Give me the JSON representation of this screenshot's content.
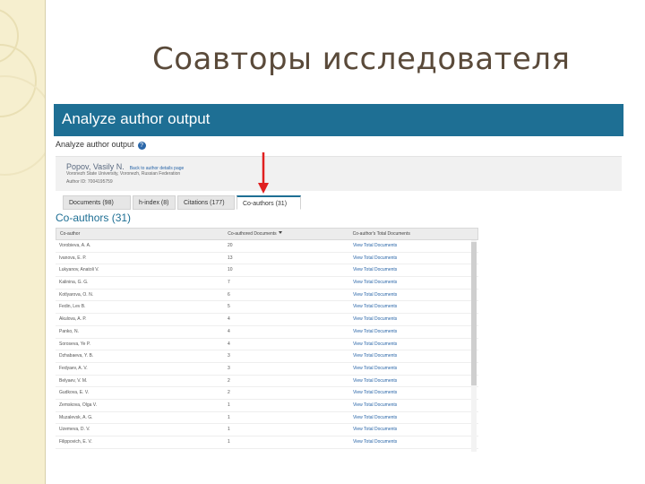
{
  "slide": {
    "title": "Соавторы исследователя"
  },
  "app": {
    "header": "Analyze author output",
    "breadcrumb": "Analyze author output",
    "help_glyph": "?",
    "accent": "#1e6f94"
  },
  "author": {
    "name": "Popov, Vasily N.",
    "link": "Back to author details page",
    "affiliation": "Voronezh State University, Voronezh, Russian Federation",
    "id": "Author ID: 7004195759"
  },
  "tabs": [
    {
      "label": "Documents (98)",
      "active": false
    },
    {
      "label": "h-index (8)",
      "active": false
    },
    {
      "label": "Citations (177)",
      "active": false
    },
    {
      "label": "Co-authors (31)",
      "active": true
    }
  ],
  "section_title": "Co-authors (31)",
  "table": {
    "headers": [
      "Co-author",
      "Co-authored Documents",
      "Co-author's Total Documents"
    ],
    "rows": [
      {
        "name": "Vorobieva, A. A.",
        "count": "20",
        "link": "View Total Documents"
      },
      {
        "name": "Ivanova, E. P.",
        "count": "13",
        "link": "View Total Documents"
      },
      {
        "name": "Lukyanov, Anatoli V.",
        "count": "10",
        "link": "View Total Documents"
      },
      {
        "name": "Kalinina, G. G.",
        "count": "7",
        "link": "View Total Documents"
      },
      {
        "name": "Kotlyarova, O. N.",
        "count": "6",
        "link": "View Total Documents"
      },
      {
        "name": "Fedin, Lev B.",
        "count": "5",
        "link": "View Total Documents"
      },
      {
        "name": "Akulova, A. P.",
        "count": "4",
        "link": "View Total Documents"
      },
      {
        "name": "Panko, N.",
        "count": "4",
        "link": "View Total Documents"
      },
      {
        "name": "Soroseva, Ye P.",
        "count": "4",
        "link": "View Total Documents"
      },
      {
        "name": "Dzhabaeva, Y. B.",
        "count": "3",
        "link": "View Total Documents"
      },
      {
        "name": "Fedyaev, A. V.",
        "count": "3",
        "link": "View Total Documents"
      },
      {
        "name": "Belyaev, V. M.",
        "count": "2",
        "link": "View Total Documents"
      },
      {
        "name": "Gudkova, E. V.",
        "count": "2",
        "link": "View Total Documents"
      },
      {
        "name": "Zemskova, Olga V.",
        "count": "1",
        "link": "View Total Documents"
      },
      {
        "name": "Muzalevsk, A. G.",
        "count": "1",
        "link": "View Total Documents"
      },
      {
        "name": "Uzemeva, D. V.",
        "count": "1",
        "link": "View Total Documents"
      },
      {
        "name": "Filippovich, E. V.",
        "count": "1",
        "link": "View Total Documents"
      }
    ]
  }
}
